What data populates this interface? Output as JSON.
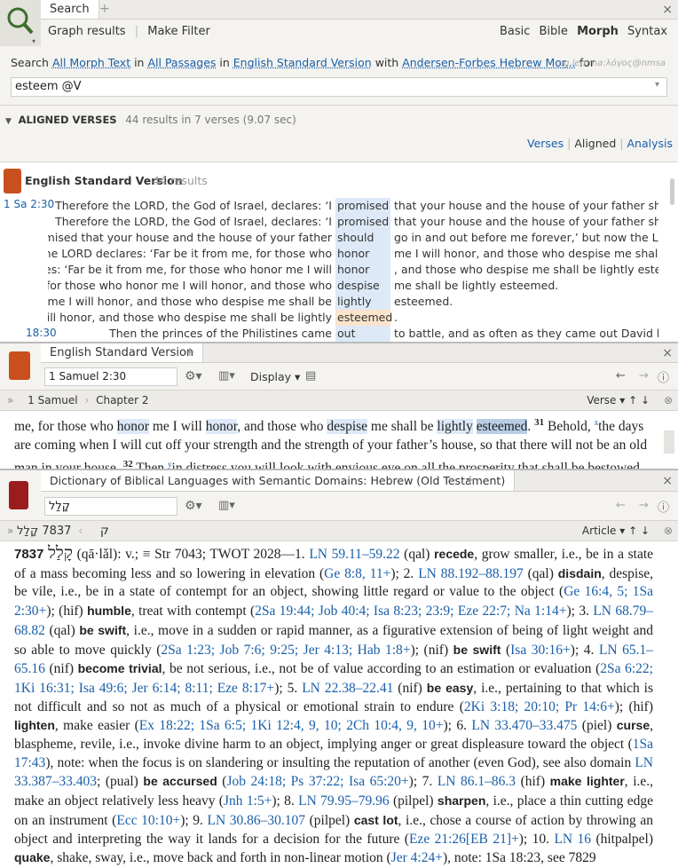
{
  "search": {
    "tab_label": "Search",
    "links": [
      "Graph results",
      "Make Filter"
    ],
    "modes": [
      "Basic",
      "Bible",
      "Morph",
      "Syntax"
    ],
    "active_mode": "Morph",
    "query_line": {
      "prefix": "Search",
      "what": "All Morph Text",
      "in_word": "in",
      "where": "All Passages",
      "in2": "in",
      "version": "English Standard Version",
      "with": "with",
      "morph": "Andersen-Forbes Hebrew Mor...",
      "for": "for"
    },
    "hint": "eg lemma:λόγος@nmsa",
    "query": "esteem @V",
    "aligned_label": "ALIGNED VERSES",
    "results_summary": "44 results in 7 verses (9.07 sec)",
    "views": [
      "Verses",
      "Aligned",
      "Analysis"
    ],
    "version_title": "English Standard Version",
    "version_count": "44 results",
    "ref1": "1 Sa  2:30",
    "ref2": "18:30",
    "rows": [
      {
        "left": "Therefore the LORD, the God of Israel, declares: ‘I",
        "hit": "promised",
        "right": "that your house and the house of your father should go",
        "style": "hl"
      },
      {
        "left": "Therefore the LORD, the God of Israel, declares: ‘I",
        "hit": "promised",
        "right": "that your house and the house of your father should go",
        "style": "hl"
      },
      {
        "left": "promised that your house and the house of your father",
        "hit": "should",
        "right": "go in and out before me forever,’ but now the LORD dec",
        "style": "hl"
      },
      {
        "left": "ow the LORD declares: ‘Far be it from me, for those who",
        "hit": "honor",
        "right": "me I will honor, and those who despise me shall be light",
        "style": "hl"
      },
      {
        "left": "clares: ‘Far be it from me, for those who honor me I will",
        "hit": "honor",
        "right": ", and those who despise me shall be lightly esteemed.",
        "style": "hl"
      },
      {
        "left": "me, for those who honor me I will honor, and those who",
        "hit": "despise",
        "right": "me shall be lightly esteemed.",
        "style": "hl"
      },
      {
        "left": "onor me I will honor, and those who despise me shall be",
        "hit": "lightly",
        "right": "esteemed.",
        "style": "hl"
      },
      {
        "left": "e I will honor, and those who despise me shall be lightly",
        "hit": "esteemed",
        "right": ".",
        "style": "hlo"
      },
      {
        "left": "Then the princes of the Philistines came",
        "hit": "out",
        "right": "to battle, and as often as they came out David had mor",
        "style": "hl"
      }
    ]
  },
  "esv": {
    "tab_label": "English Standard Version",
    "reference": "1 Samuel 2:30",
    "display": "Display",
    "breadcrumb": [
      "1 Samuel",
      "Chapter 2"
    ],
    "verse_mode": "Verse",
    "text": {
      "t1": "me, for those who ",
      "w1": "honor",
      "t2": " me I will ",
      "w2": "honor",
      "t3": ", and those who ",
      "w3": "despise",
      "t4": " me shall be ",
      "w4": "lightly",
      "t5": " ",
      "w5": "esteemed",
      "t6": ". ",
      "v31": "31",
      "t7": " Behold, ",
      "x": "x",
      "t8": "the days are coming when I will cut off your strength and the strength of your father’s house, so that there will not be an old man in your house. ",
      "v32": "32",
      "t9": " Then ",
      "y": "y",
      "t10": "in distress you will look with envious eye on all the prosperity that shall be bestowed"
    }
  },
  "dbl": {
    "tab_label": "Dictionary of Biblical Languages with Semantic Domains: Hebrew (Old Testament)",
    "lookup": "קָלַל",
    "breadcrumb": [
      "ק",
      "7837 קָלַל"
    ],
    "article_mode": "Article",
    "entry": {
      "num": "7837",
      "lemma": "קָלַל",
      "translit": "(qā·lǎl)",
      "head_rest": ": v.; ≡ Str 7043; TWOT 2028—1. ",
      "text": [
        {
          "ref": "LN 59.11–59.22",
          "t": " (qal) "
        },
        {
          "b": "recede"
        },
        {
          "t": ", grow smaller, i.e., be in a state of a mass becoming less and so lowering in elevation ("
        },
        {
          "ref": "Ge 8:8, 11+"
        },
        {
          "t": "); 2. "
        },
        {
          "ref": "LN 88.192–88.197"
        },
        {
          "t": " (qal) "
        },
        {
          "b": "disdain"
        },
        {
          "t": ", despise, be vile, i.e., be in a state of contempt for an object, showing little regard or value to the object ("
        },
        {
          "ref": "Ge 16:4, 5; 1Sa 2:30+"
        },
        {
          "t": "); (hif) "
        },
        {
          "b": "humble"
        },
        {
          "t": ", treat with contempt ("
        },
        {
          "ref": "2Sa 19:44; Job 40:4; Isa 8:23; 23:9; Eze 22:7; Na 1:14+"
        },
        {
          "t": "); 3. "
        },
        {
          "ref": "LN 68.79–68.82"
        },
        {
          "t": " (qal) "
        },
        {
          "b": "be swift"
        },
        {
          "t": ", i.e., move in a sudden or rapid manner, as a figurative extension of being of light weight and so able to move quickly ("
        },
        {
          "ref": "2Sa 1:23; Job 7:6; 9:25; Jer 4:13; Hab 1:8+"
        },
        {
          "t": "); (nif) "
        },
        {
          "b": "be swift"
        },
        {
          "t": " ("
        },
        {
          "ref": "Isa 30:16+"
        },
        {
          "t": "); 4. "
        },
        {
          "ref": "LN 65.1–65.16"
        },
        {
          "t": " (nif) "
        },
        {
          "b": "become trivial"
        },
        {
          "t": ", be not serious, i.e., not be of value according to an estimation or evaluation ("
        },
        {
          "ref": "2Sa 6:22; 1Ki 16:31; Isa 49:6; Jer 6:14; 8:11; Eze 8:17+"
        },
        {
          "t": "); 5. "
        },
        {
          "ref": "LN 22.38–22.41"
        },
        {
          "t": " (nif) "
        },
        {
          "b": "be easy"
        },
        {
          "t": ", i.e., pertaining to that which is not difficult and so not as much of a physical or emotional strain to endure ("
        },
        {
          "ref": "2Ki 3:18; 20:10; Pr 14:6+"
        },
        {
          "t": "); (hif) "
        },
        {
          "b": "lighten"
        },
        {
          "t": ", make easier ("
        },
        {
          "ref": "Ex 18:22; 1Sa 6:5; 1Ki 12:4, 9, 10; 2Ch 10:4, 9, 10+"
        },
        {
          "t": "); 6. "
        },
        {
          "ref": "LN 33.470–33.475"
        },
        {
          "t": " (piel) "
        },
        {
          "b": "curse"
        },
        {
          "t": ", blaspheme, revile, i.e., invoke divine harm to an object, implying anger or great displeasure toward the object ("
        },
        {
          "ref": "1Sa 17:43"
        },
        {
          "t": "), note: when the focus is on slandering or insulting the reputation of another (even God), see also domain "
        },
        {
          "ref": "LN 33.387–33.403"
        },
        {
          "t": "; (pual) "
        },
        {
          "b": "be accursed"
        },
        {
          "t": " ("
        },
        {
          "ref": "Job 24:18; Ps 37:22; Isa 65:20+"
        },
        {
          "t": "); 7. "
        },
        {
          "ref": "LN 86.1–86.3"
        },
        {
          "t": " (hif) "
        },
        {
          "b": "make lighter"
        },
        {
          "t": ", i.e., make an object relatively less heavy ("
        },
        {
          "ref": "Jnh 1:5+"
        },
        {
          "t": "); 8. "
        },
        {
          "ref": "LN 79.95–79.96"
        },
        {
          "t": " (pilpel) "
        },
        {
          "b": "sharpen"
        },
        {
          "t": ", i.e., place a thin cutting edge on an instrument ("
        },
        {
          "ref": "Ecc 10:10+"
        },
        {
          "t": "); 9. "
        },
        {
          "ref": "LN 30.86–30.107"
        },
        {
          "t": " (pilpel) "
        },
        {
          "b": "cast lot"
        },
        {
          "t": ", i.e., chose a course of action by throwing an object and interpreting the way it lands for a decision for the future ("
        },
        {
          "ref": "Eze 21:26[EB 21]+"
        },
        {
          "t": "); 10. "
        },
        {
          "ref": "LN 16"
        },
        {
          "t": " (hitpalpel) "
        },
        {
          "b": "quake"
        },
        {
          "t": ", shake, sway, i.e., move back and forth in non-linear motion ("
        },
        {
          "ref": "Jer 4:24+"
        },
        {
          "t": "), note: 1Sa 18:23, see 7829"
        }
      ]
    }
  }
}
